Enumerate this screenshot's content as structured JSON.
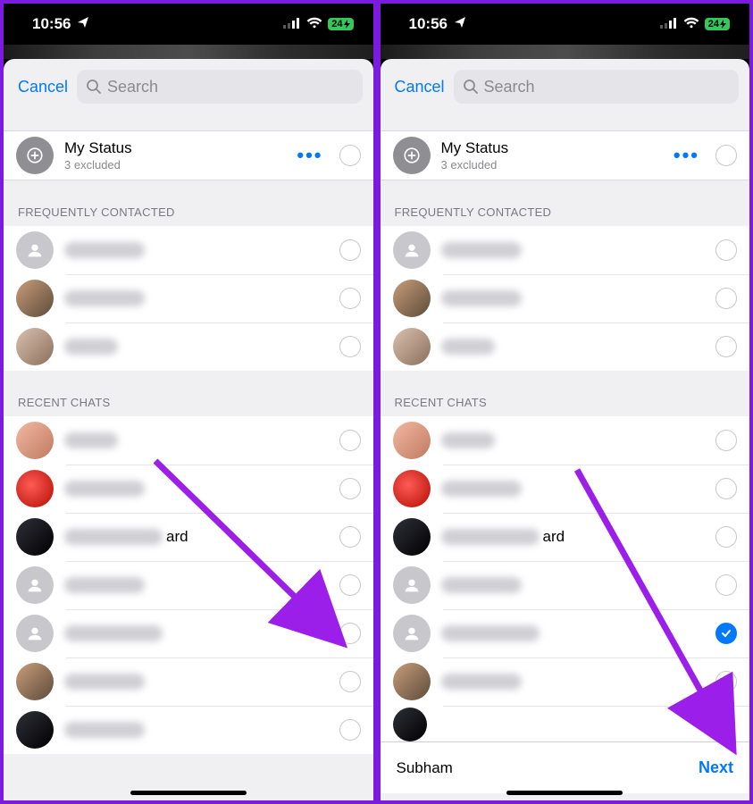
{
  "status": {
    "time": "10:56",
    "battery": "24"
  },
  "sheet": {
    "cancel": "Cancel",
    "search_placeholder": "Search",
    "my_status_title": "My Status",
    "my_status_sub": "3 excluded",
    "section_frequent": "FREQUENTLY CONTACTED",
    "section_recent": "RECENT CHATS",
    "ard_suffix": "ard"
  },
  "bottom": {
    "selected_name": "Subham",
    "next": "Next"
  },
  "arrow_color": "#9b1fe8"
}
